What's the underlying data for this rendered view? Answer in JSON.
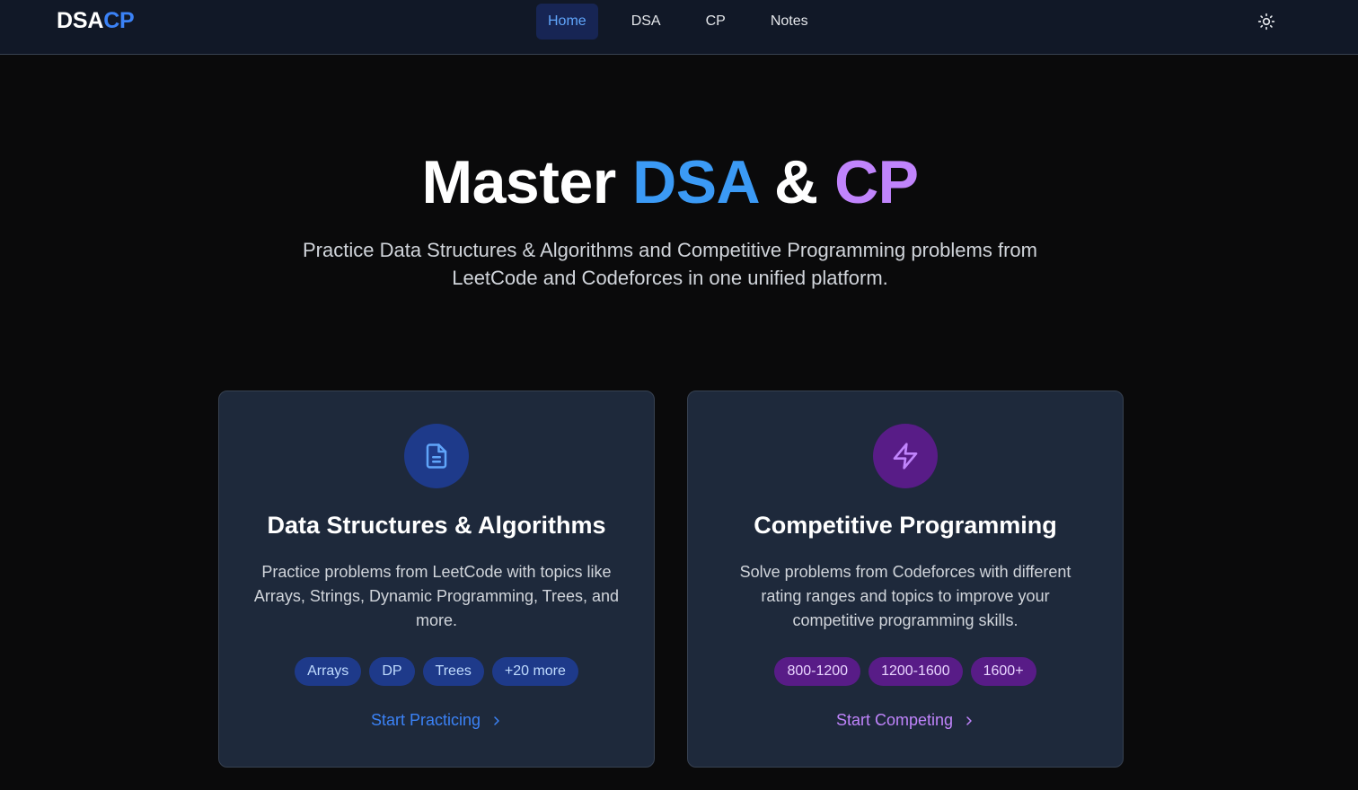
{
  "header": {
    "logo_part1": "DSA",
    "logo_part2": "CP",
    "nav": [
      {
        "label": "Home",
        "active": true
      },
      {
        "label": "DSA",
        "active": false
      },
      {
        "label": "CP",
        "active": false
      },
      {
        "label": "Notes",
        "active": false
      }
    ],
    "theme_icon": "sun-icon"
  },
  "hero": {
    "title_prefix": "Master",
    "title_dsa": "DSA",
    "title_amp": "&",
    "title_cp": "CP",
    "subtitle_line1": "Practice Data Structures & Algorithms and Competitive Programming problems from",
    "subtitle_line2": "LeetCode and Codeforces in one unified platform."
  },
  "cards": [
    {
      "icon": "document-icon",
      "title": "Data Structures & Algorithms",
      "desc_lines": [
        "Practice problems from LeetCode with topics like",
        "Arrays, Strings, Dynamic Programming, Trees, and",
        "more."
      ],
      "tags": [
        "Arrays",
        "DP",
        "Trees",
        "+20 more"
      ],
      "link": "Start Practicing"
    },
    {
      "icon": "lightning-icon",
      "title": "Competitive Programming",
      "desc_lines": [
        "Solve problems from Codeforces with different",
        "rating ranges and topics to improve your",
        "competitive programming skills."
      ],
      "tags": [
        "800-1200",
        "1200-1600",
        "1600+"
      ],
      "link": "Start Competing"
    }
  ],
  "colors": {
    "background": "#0a0a0b",
    "navbar": "#111827",
    "card": "#1e293b",
    "dsa_accent": "#3b82f6",
    "cp_accent": "#c084fc"
  }
}
